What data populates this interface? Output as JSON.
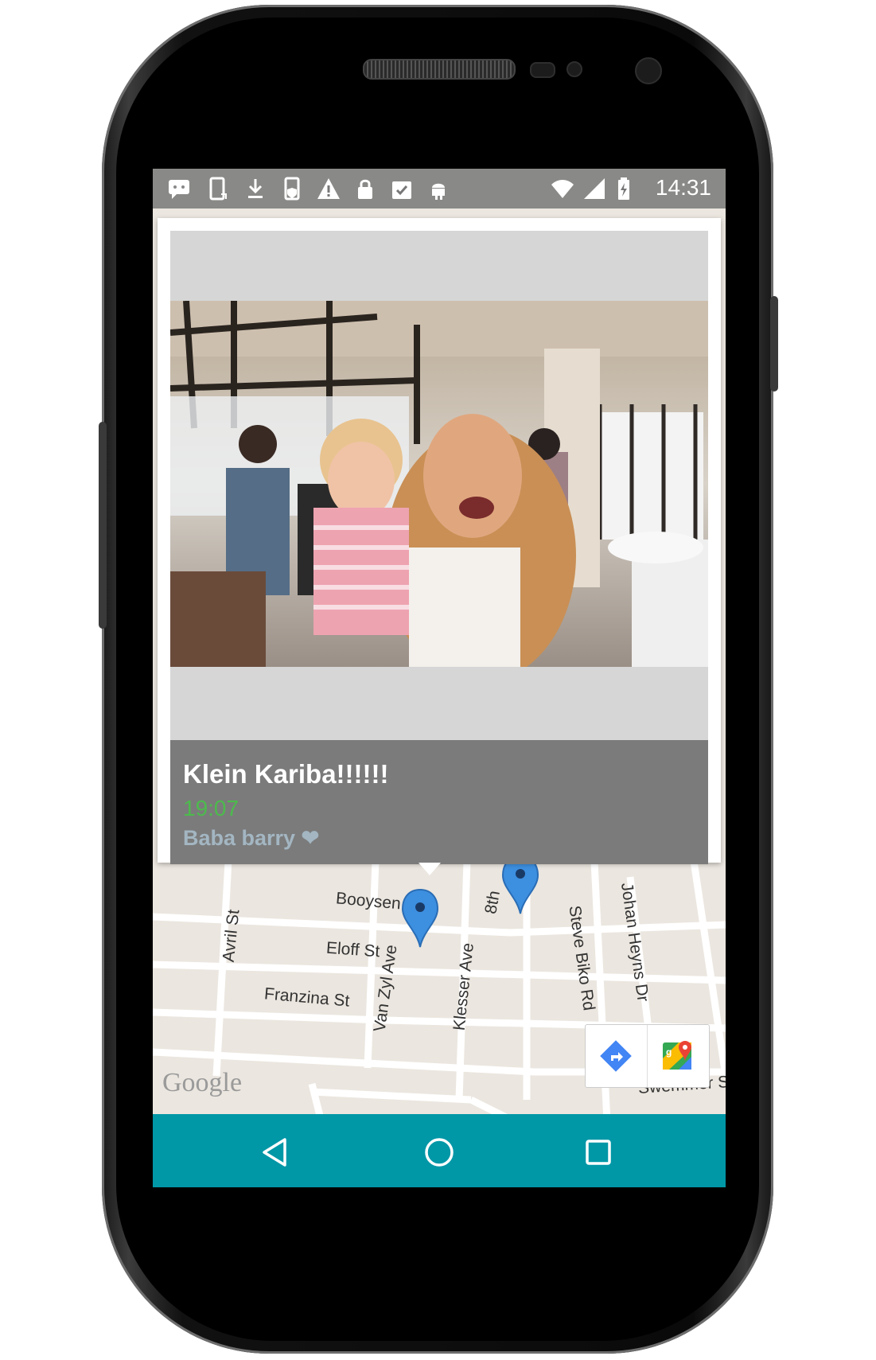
{
  "status_bar": {
    "time": "14:31",
    "icons": [
      "message-icon",
      "phone-rotate-icon",
      "download-icon",
      "phone-shield-icon",
      "warning-icon",
      "lock-icon",
      "clipboard-check-icon",
      "android-icon",
      "wifi-icon",
      "signal-icon",
      "battery-icon"
    ]
  },
  "post": {
    "title": "Klein Kariba!!!!!!",
    "time": "19:07",
    "user": "Baba barry ❤"
  },
  "map": {
    "streets": [
      "Avril St",
      "Booysen St",
      "Eloff St",
      "Van Zyl Ave",
      "Klesser Ave",
      "8th",
      "Steve Biko Rd",
      "Johan Heyns Dr",
      "Franzina St",
      "Swemmer S"
    ],
    "attribution": "Google",
    "markers": 2
  },
  "nav": {
    "back": "back-icon",
    "home": "home-icon",
    "recents": "recents-icon"
  },
  "colors": {
    "nav_bar": "#0097a7",
    "info_panel": "#7b7b7b",
    "time_text": "#4cbb4c",
    "user_text": "#a3b6c2",
    "marker": "#3d8fe0"
  }
}
